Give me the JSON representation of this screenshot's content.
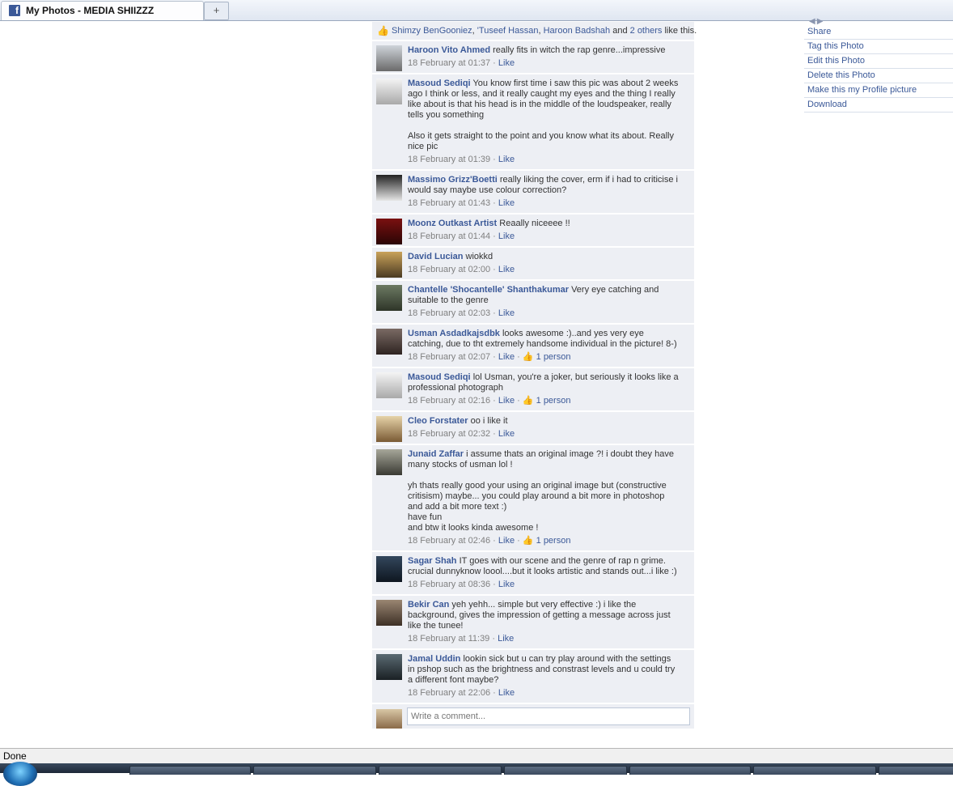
{
  "browser": {
    "tab_title": "My Photos - MEDIA SHIIZZZ",
    "new_tab_glyph": "+",
    "status": "Done"
  },
  "likes": {
    "names": [
      "Shimzy BenGooniez",
      "'Tuseef Hassan",
      "Haroon Badshah"
    ],
    "sep1": ", ",
    "sep2": ", ",
    "and": " and ",
    "others": "2 others",
    "suffix": " like this."
  },
  "like_label": "Like",
  "comments": [
    {
      "author": "Haroon Vito Ahmed",
      "text": "really fits in witch the rap genre...impressive",
      "time": "18 February at 01:37",
      "likes": ""
    },
    {
      "author": "Masoud Sediqi",
      "text": "You know first time i saw this pic was about 2 weeks ago I think or less, and it really caught my eyes and the thing I really like about is that his head is in the middle of the loudspeaker, really tells you something\n\nAlso it gets straight to the point and you know what its about. Really nice pic",
      "time": "18 February at 01:39",
      "likes": ""
    },
    {
      "author": "Massimo Grizz'Boetti",
      "text": "really liking the cover, erm if i had to criticise i would say maybe use colour correction?",
      "time": "18 February at 01:43",
      "likes": ""
    },
    {
      "author": "Moonz Outkast Artist",
      "text": "Reaally niceeee !!",
      "time": "18 February at 01:44",
      "likes": ""
    },
    {
      "author": "David Lucian",
      "text": "wiokkd",
      "time": "18 February at 02:00",
      "likes": ""
    },
    {
      "author": "Chantelle 'Shocantelle' Shanthakumar",
      "text": "Very eye catching and suitable to the genre",
      "time": "18 February at 02:03",
      "likes": ""
    },
    {
      "author": "Usman Asdadkajsdbk",
      "text": "looks awesome :)..and yes very eye catching, due to tht extremely handsome individual in the picture! 8-)",
      "time": "18 February at 02:07",
      "likes": "1 person"
    },
    {
      "author": "Masoud Sediqi",
      "text": "lol Usman, you're a joker, but seriously it looks like a professional photograph",
      "time": "18 February at 02:16",
      "likes": "1 person"
    },
    {
      "author": "Cleo Forstater",
      "text": "oo i like it",
      "time": "18 February at 02:32",
      "likes": ""
    },
    {
      "author": "Junaid Zaffar",
      "text": "i assume thats an original image ?! i doubt they have many stocks of usman lol !\n\nyh thats really good your using an original image but (constructive critisism) maybe... you could play around a bit more in photoshop and add a bit more text :)\nhave fun\nand btw it looks kinda awesome !",
      "time": "18 February at 02:46",
      "likes": "1 person"
    },
    {
      "author": "Sagar Shah",
      "text": "IT goes with our scene and the genre of rap n grime. crucial dunnyknow loool....but it looks artistic and stands out...i like :)",
      "time": "18 February at 08:36",
      "likes": ""
    },
    {
      "author": "Bekir Can",
      "text": "yeh yehh... simple but very effective :) i like the background, gives the impression of getting a message across just like the tunee!",
      "time": "18 February at 11:39",
      "likes": ""
    },
    {
      "author": "Jamal Uddin",
      "text": "lookin sick but u can try play around with the settings in pshop such as the brightness and constrast levels and u could try a different font maybe?",
      "time": "18 February at 22:06",
      "likes": ""
    }
  ],
  "comment_input": {
    "placeholder": "Write a comment..."
  },
  "actions": [
    "Share",
    "Tag this Photo",
    "Edit this Photo",
    "Delete this Photo",
    "Make this my Profile picture",
    "Download"
  ],
  "icons": {
    "like": "thumbs-up-icon",
    "tab": "facebook-icon",
    "start": "windows-start-icon"
  },
  "colors": {
    "link": "#3b5998",
    "comment_bg": "#edeff4",
    "meta": "#808080"
  }
}
